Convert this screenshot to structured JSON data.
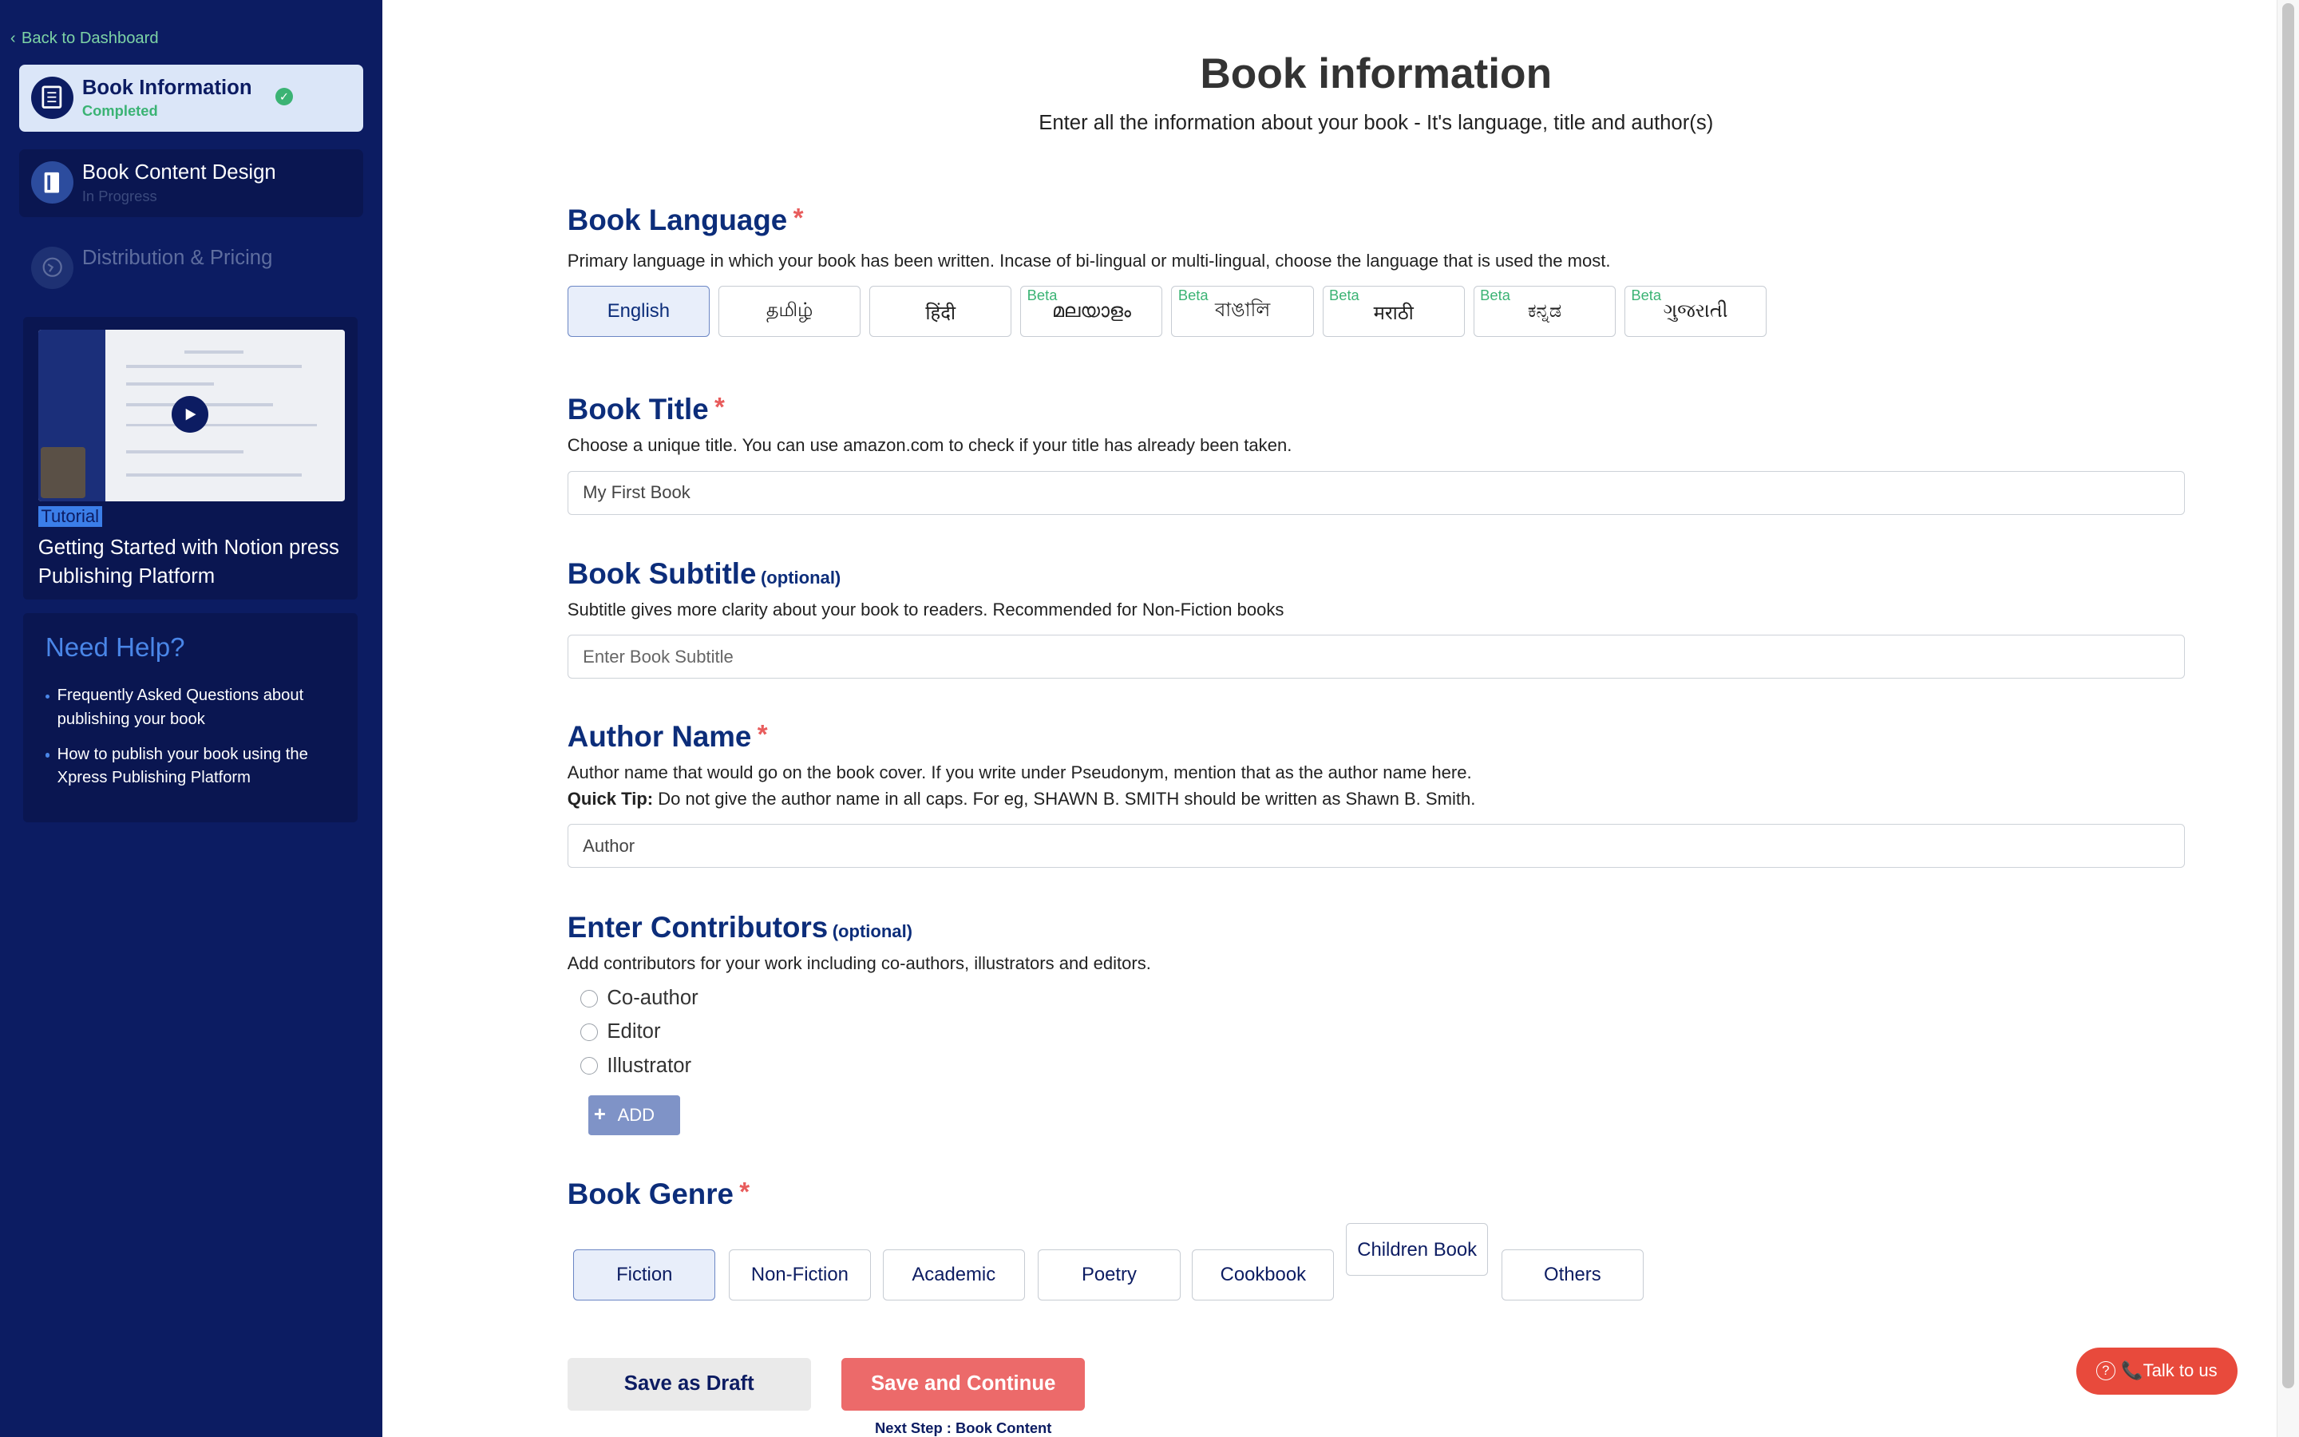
{
  "sidebar": {
    "back_link": "Back to Dashboard",
    "steps": [
      {
        "title": "Book Information",
        "status": "Completed"
      },
      {
        "title": "Book Content Design",
        "status": "In Progress"
      },
      {
        "title": "Distribution & Pricing",
        "status": ""
      }
    ],
    "tutorial": {
      "badge": "Tutorial",
      "title": "Getting Started with Notion press Publishing Platform"
    },
    "help": {
      "title": "Need Help?",
      "links": [
        "Frequently Asked Questions about publishing your book",
        "How to publish your book using the Xpress Publishing Platform"
      ]
    }
  },
  "page": {
    "title": "Book information",
    "subtitle": "Enter all the information about your book - It's language, title and author(s)"
  },
  "language": {
    "heading": "Book Language",
    "required_mark": "*",
    "description": "Primary language in which your book has been written. Incase of bi-lingual or multi-lingual, choose the language that is used the most.",
    "beta_label": "Beta",
    "options": [
      "English",
      "தமிழ்",
      "हिंदी",
      "മലയാളം",
      "বাঙালি",
      "मराठी",
      "ಕನ್ನಡ",
      "ગુજરાતી"
    ],
    "selected": "English"
  },
  "title_field": {
    "heading": "Book Title",
    "required_mark": "*",
    "description": "Choose a unique title. You can use amazon.com to check if your title has already been taken.",
    "value": "My First Book"
  },
  "subtitle_field": {
    "heading": "Book Subtitle",
    "optional": "(optional)",
    "description": "Subtitle gives more clarity about your book to readers. Recommended for Non-Fiction books",
    "placeholder": "Enter Book Subtitle"
  },
  "author_field": {
    "heading": "Author Name",
    "required_mark": "*",
    "description": "Author name that would go on the book cover. If you write under Pseudonym, mention that as the author name here.",
    "tip_label": "Quick Tip:",
    "tip_text": " Do not give the author name in all caps. For eg, SHAWN B. SMITH should be written as Shawn B. Smith.",
    "value": "Author"
  },
  "contributors": {
    "heading": "Enter Contributors",
    "optional": "(optional)",
    "description": "Add contributors for your work including co-authors, illustrators and editors.",
    "options": [
      "Co-author",
      "Editor",
      "Illustrator"
    ],
    "add_label": "ADD"
  },
  "genre": {
    "heading": "Book Genre",
    "required_mark": "*",
    "options": [
      "Fiction",
      "Non-Fiction",
      "Academic",
      "Poetry",
      "Cookbook",
      "Children Book",
      "Others"
    ],
    "selected": "Fiction"
  },
  "actions": {
    "draft": "Save as Draft",
    "continue": "Save and Continue",
    "next_step": "Next Step : Book Content"
  },
  "support": {
    "label": "📞Talk to us"
  }
}
